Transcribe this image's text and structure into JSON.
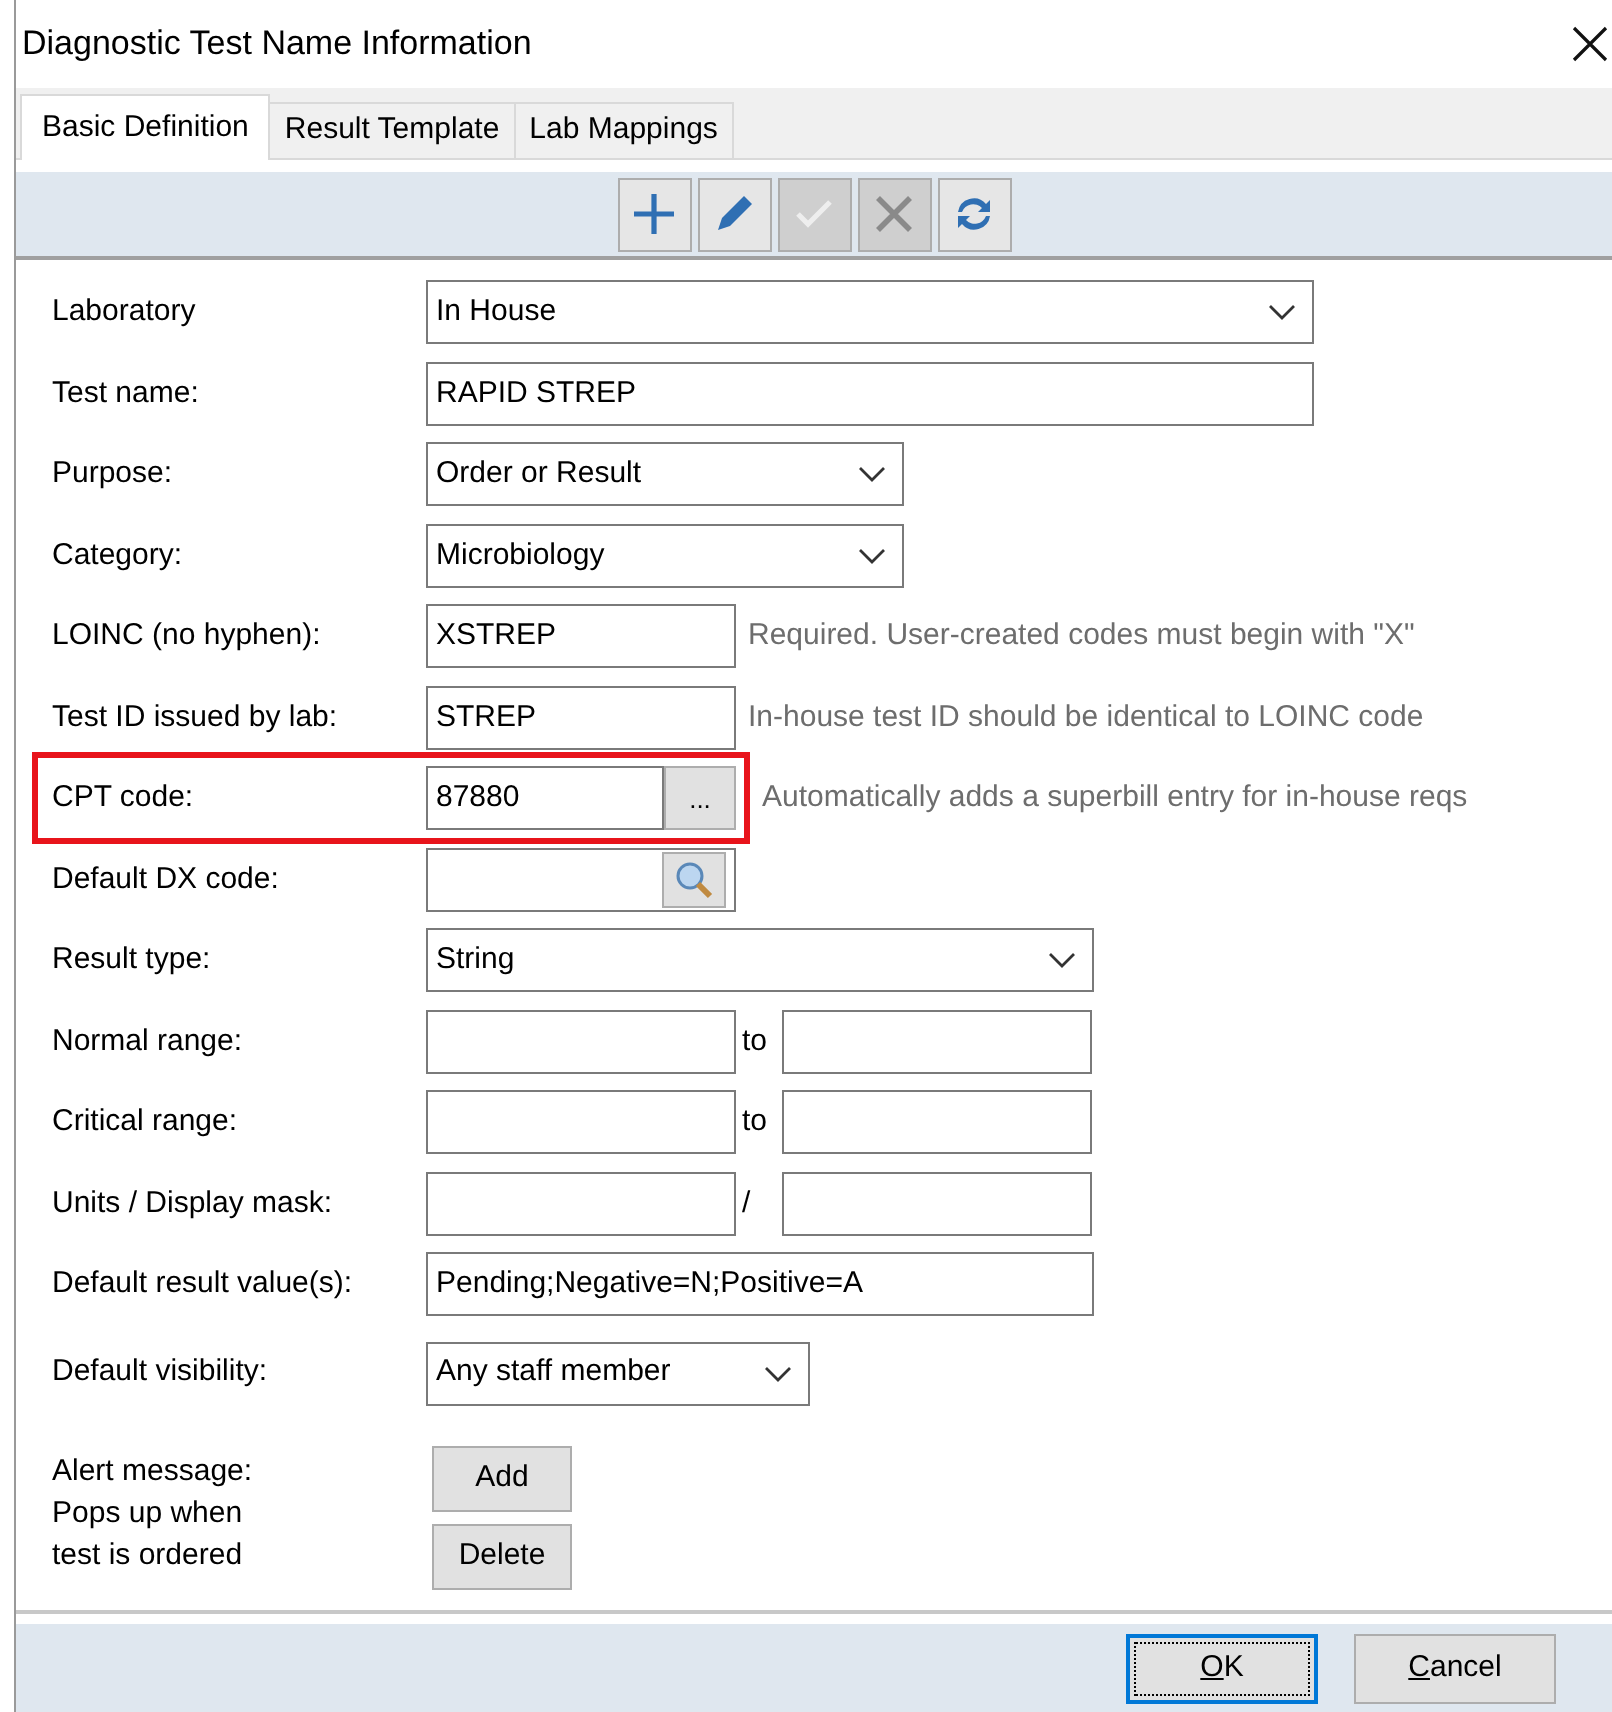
{
  "window": {
    "title": "Diagnostic Test Name Information"
  },
  "tabs": [
    {
      "label": "Basic Definition",
      "selected": true
    },
    {
      "label": "Result Template",
      "selected": false
    },
    {
      "label": "Lab Mappings",
      "selected": false
    }
  ],
  "toolbar": [
    {
      "kind": "add",
      "disabled": false
    },
    {
      "kind": "edit",
      "disabled": false
    },
    {
      "kind": "save",
      "disabled": true
    },
    {
      "kind": "delete",
      "disabled": true
    },
    {
      "kind": "refresh",
      "disabled": false
    }
  ],
  "form": [
    {
      "kind": "select",
      "label": "Laboratory",
      "value": "In House"
    },
    {
      "kind": "text",
      "label": "Test name:",
      "value": "RAPID STREP"
    },
    {
      "kind": "select",
      "label": "Purpose:",
      "value": "Order or Result"
    },
    {
      "kind": "select",
      "label": "Category:",
      "value": "Microbiology"
    },
    {
      "kind": "text",
      "label": "LOINC (no hyphen):",
      "value": "XSTREP",
      "hint": "Required. User-created codes must begin with \"X\""
    },
    {
      "kind": "text",
      "label": "Test ID issued by lab:",
      "value": "STREP",
      "hint": "In-house test ID should be identical to LOINC code"
    },
    {
      "kind": "browse",
      "label": "CPT code:",
      "value": "87880",
      "button": "...",
      "hint": "Automatically adds a superbill entry for in-house reqs",
      "highlighted": true
    },
    {
      "kind": "lookup",
      "label": "Default DX code:"
    },
    {
      "kind": "select",
      "label": "Result type:",
      "value": "String"
    },
    {
      "kind": "pair",
      "label": "Normal range:",
      "separator": "to"
    },
    {
      "kind": "pair",
      "label": "Critical range:",
      "separator": "to"
    },
    {
      "kind": "pair",
      "label": "Units / Display mask:",
      "separator": "/"
    },
    {
      "kind": "text",
      "label": "Default result value(s):",
      "value": "Pending;Negative=N;Positive=A"
    },
    {
      "kind": "select",
      "label": "Default visibility:",
      "value": "Any staff member"
    }
  ],
  "alert": {
    "label_lines": [
      "Alert message:",
      "Pops up when",
      "test is ordered"
    ],
    "buttons": [
      "Add",
      "Delete"
    ]
  },
  "footer": [
    {
      "label": "OK",
      "default": true,
      "accelerator_underlined": true
    },
    {
      "label": "Cancel",
      "default": false,
      "accelerator_underlined": true
    }
  ]
}
